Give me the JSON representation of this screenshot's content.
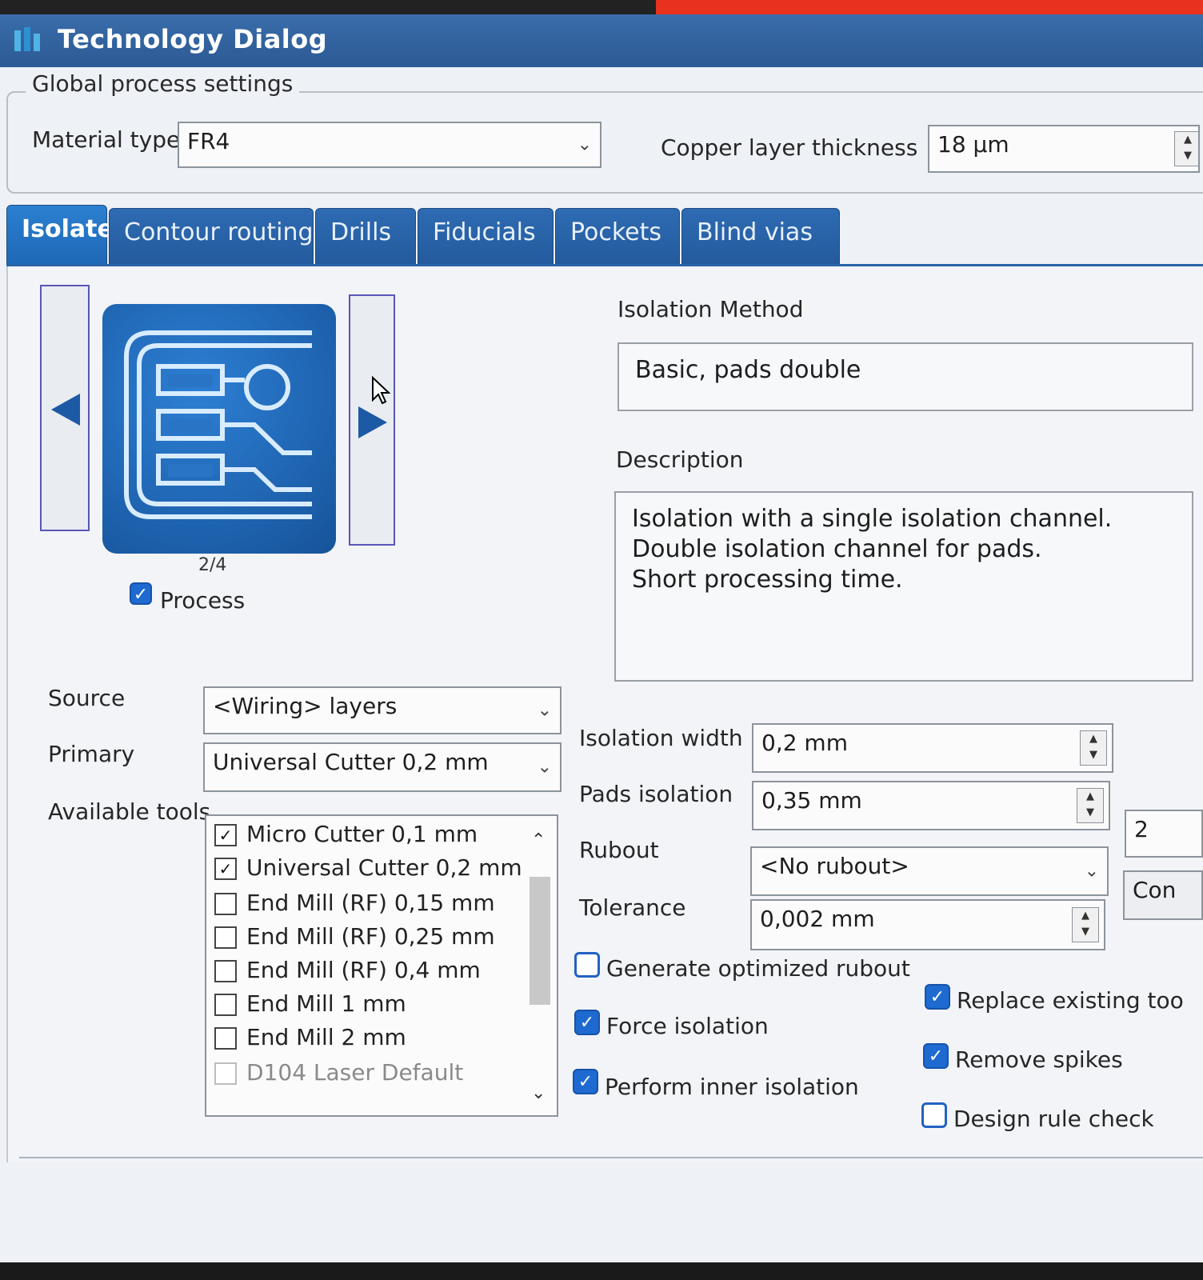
{
  "window": {
    "title": "Technology Dialog"
  },
  "global": {
    "legend": "Global process settings",
    "material_label": "Material type",
    "material_value": "FR4",
    "copper_label": "Copper layer thickness",
    "copper_value": "18 µm"
  },
  "tabs": [
    {
      "label": "Isolate",
      "active": true
    },
    {
      "label": "Contour routing"
    },
    {
      "label": "Drills"
    },
    {
      "label": "Fiducials"
    },
    {
      "label": "Pockets"
    },
    {
      "label": "Blind vias"
    }
  ],
  "isolate": {
    "preview_counter": "2/4",
    "process_label": "Process",
    "process_checked": true,
    "method_label": "Isolation Method",
    "method_value": "Basic, pads double",
    "description_label": "Description",
    "description_lines": [
      "Isolation with a single isolation channel.",
      "Double isolation channel for pads.",
      "Short processing time."
    ],
    "source_label": "Source",
    "source_value": "<Wiring> layers",
    "primary_label": "Primary",
    "primary_value": "Universal Cutter 0,2 mm",
    "tools_label": "Available tools",
    "tools": [
      {
        "name": "Micro Cutter 0,1 mm",
        "checked": true
      },
      {
        "name": "Universal Cutter 0,2 mm",
        "checked": true
      },
      {
        "name": "End Mill (RF) 0,15 mm",
        "checked": false
      },
      {
        "name": "End Mill (RF) 0,25 mm",
        "checked": false
      },
      {
        "name": "End Mill (RF) 0,4 mm",
        "checked": false
      },
      {
        "name": "End Mill 1 mm",
        "checked": false
      },
      {
        "name": "End Mill 2 mm",
        "checked": false
      },
      {
        "name": "D104 Laser Default",
        "checked": false,
        "disabled": true
      }
    ],
    "isolation_width_label": "Isolation width",
    "isolation_width_value": "0,2 mm",
    "pads_isolation_label": "Pads isolation",
    "pads_isolation_value": "0,35 mm",
    "pads_count_value": "2",
    "rubout_label": "Rubout",
    "rubout_value": "<No rubout>",
    "rubout_button": "Con",
    "tolerance_label": "Tolerance",
    "tolerance_value": "0,002 mm",
    "options_left": [
      {
        "label": "Generate optimized rubout",
        "checked": false
      },
      {
        "label": "Force isolation",
        "checked": true
      },
      {
        "label": "Perform inner isolation",
        "checked": true
      }
    ],
    "options_right": [
      {
        "label": "Replace existing too",
        "checked": true
      },
      {
        "label": "Remove spikes",
        "checked": true
      },
      {
        "label": "Design rule check",
        "checked": false
      }
    ]
  }
}
